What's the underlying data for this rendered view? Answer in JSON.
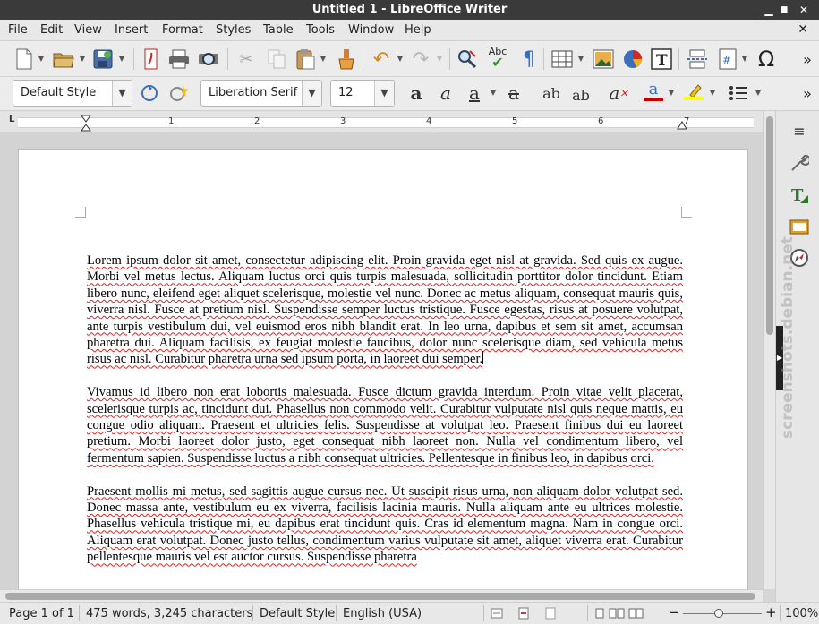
{
  "window": {
    "title": "Untitled 1 - LibreOffice Writer",
    "min_icon": "▁",
    "max_icon": "■",
    "close_icon": "✕"
  },
  "menu": {
    "items": [
      "File",
      "Edit",
      "View",
      "Insert",
      "Format",
      "Styles",
      "Table",
      "Tools",
      "Window",
      "Help"
    ],
    "close_doc": "✕"
  },
  "toolbar": {
    "more": "»",
    "para_style": "Default Style",
    "font_name": "Liberation Serif",
    "font_size": "12"
  },
  "ruler": {
    "numbers": [
      "1",
      "1",
      "2",
      "3",
      "4",
      "5",
      "6",
      "7"
    ]
  },
  "document": {
    "paragraphs": [
      "Lorem ipsum dolor sit amet, consectetur adipiscing elit. Proin gravida eget nisl at gravida. Sed quis ex augue. Morbi vel metus lectus. Aliquam luctus orci quis turpis malesuada, sollicitudin porttitor dolor tincidunt. Etiam libero nunc, eleifend eget aliquet scelerisque, molestie vel nunc. Donec ac metus aliquam, consequat mauris quis, viverra nisl. Fusce at pretium nisl. Suspendisse semper luctus tristique. Fusce egestas, risus at posuere volutpat, ante turpis vestibulum dui, vel euismod eros nibh blandit erat. In leo urna, dapibus et sem sit amet, accumsan pharetra dui. Aliquam facilisis, ex feugiat molestie faucibus, dolor nunc scelerisque diam, sed vehicula metus risus ac nisl. Curabitur pharetra urna sed ipsum porta, in laoreet dui semper.",
      "Vivamus id libero non erat lobortis malesuada. Fusce dictum gravida interdum. Proin vitae velit placerat, scelerisque turpis ac, tincidunt dui. Phasellus non commodo velit. Curabitur vulputate nisl quis neque mattis, eu congue odio aliquam. Praesent et ultricies felis. Suspendisse at volutpat leo. Praesent finibus dui eu laoreet pretium. Morbi laoreet dolor justo, eget consequat nibh laoreet non. Nulla vel condimentum libero, vel fermentum sapien. Suspendisse luctus a nibh consequat ultricies. Pellentesque in finibus leo, in dapibus orci.",
      "Praesent mollis mi metus, sed sagittis augue cursus nec. Ut suscipit risus urna, non aliquam dolor volutpat sed. Donec massa ante, vestibulum eu ex viverra, facilisis lacinia mauris. Nulla aliquam ante eu ultrices molestie. Phasellus vehicula tristique mi, eu dapibus erat tincidunt quis. Cras id elementum magna. Nam in congue orci. Aliquam erat volutpat. Donec justo tellus, condimentum varius vulputate sit amet, aliquet viverra erat. Curabitur pellentesque mauris vel est auctor cursus. Suspendisse pharetra"
    ]
  },
  "statusbar": {
    "page": "Page 1 of 1",
    "counts": "475 words, 3,245 characters",
    "style": "Default Style",
    "language": "English (USA)",
    "zoom": "100%",
    "zoom_fraction": 0.45
  },
  "watermark": "screenshots.debian.net",
  "colors": {
    "font_color": "#c00000",
    "highlight": "#ffff00",
    "titlebar": "#3a3a3a"
  }
}
